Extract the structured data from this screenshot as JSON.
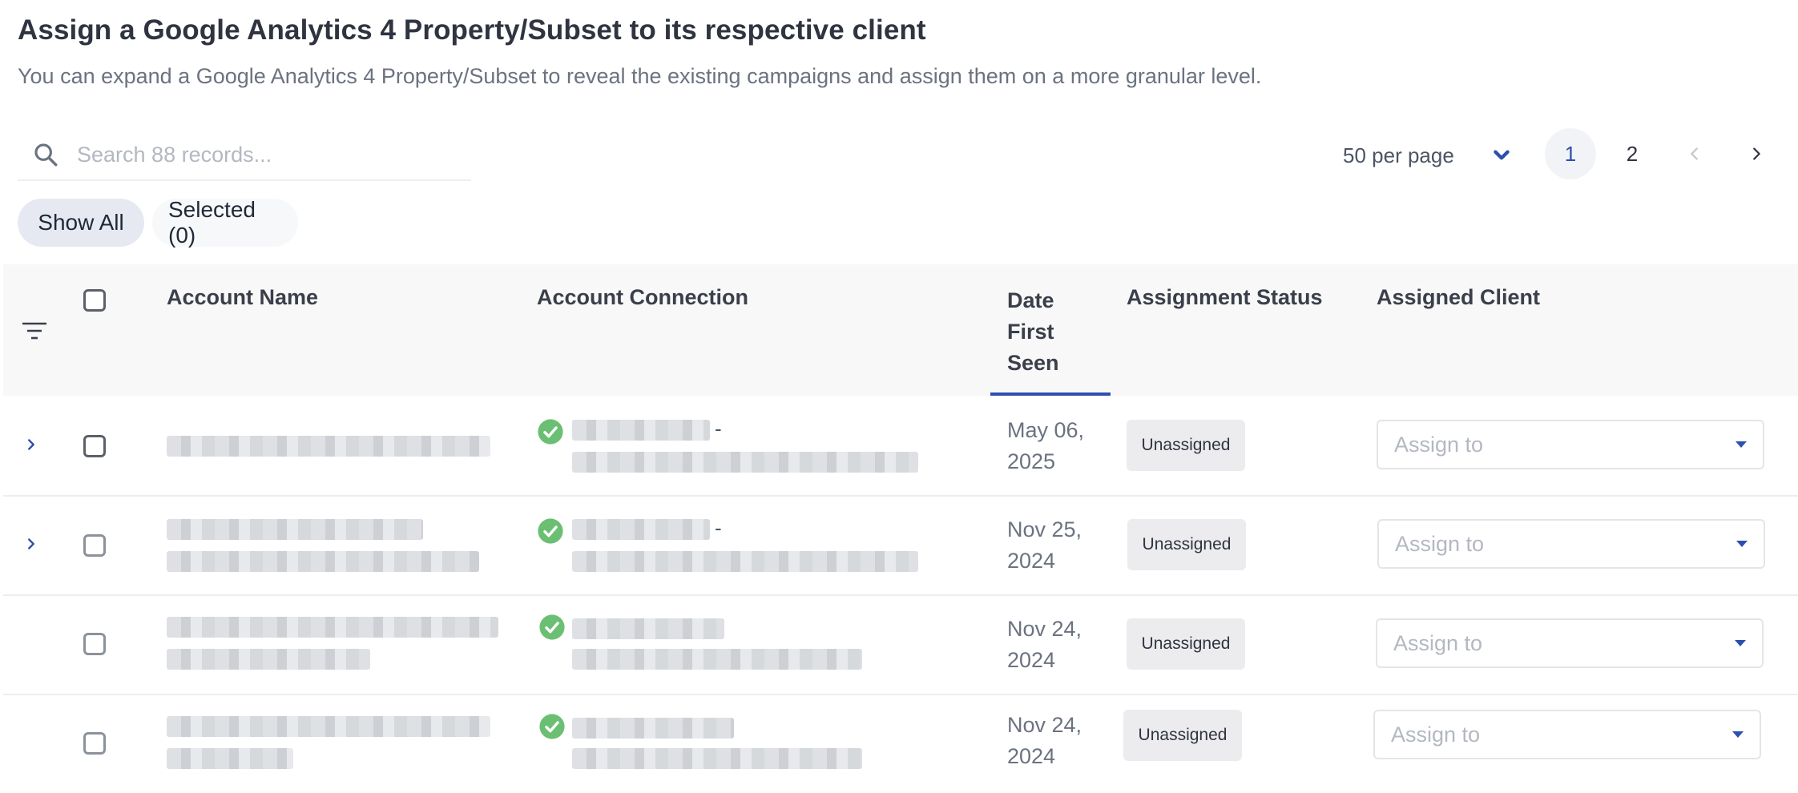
{
  "header": {
    "title": "Assign a Google Analytics 4 Property/Subset to its respective client",
    "subtitle": "You can expand a Google Analytics 4 Property/Subset to reveal the existing campaigns and assign them on a more granular level."
  },
  "search": {
    "placeholder": "Search 88 records..."
  },
  "pagination": {
    "per_page": "50 per page",
    "pages": [
      "1",
      "2"
    ],
    "current_page": "1"
  },
  "filters": {
    "show_all": "Show All",
    "selected": "Selected (0)"
  },
  "table": {
    "columns": {
      "account_name": "Account Name",
      "account_connection": "Account Connection",
      "date_line1": "Date",
      "date_line2": "First",
      "date_line3": "Seen",
      "assignment_status": "Assignment Status",
      "assigned_client": "Assigned Client"
    },
    "rows": [
      {
        "date_line1": "May 06,",
        "date_line2": "2025",
        "status": "Unassigned",
        "assign_placeholder": "Assign to",
        "connection_dash": "-"
      },
      {
        "date_line1": "Nov 25,",
        "date_line2": "2024",
        "status": "Unassigned",
        "assign_placeholder": "Assign to",
        "connection_dash": "-"
      },
      {
        "date_line1": "Nov 24,",
        "date_line2": "2024",
        "status": "Unassigned",
        "assign_placeholder": "Assign to"
      },
      {
        "date_line1": "Nov 24,",
        "date_line2": "2024",
        "status": "Unassigned",
        "assign_placeholder": "Assign to"
      }
    ]
  },
  "colors": {
    "accent": "#2d4fae",
    "success": "#6bbf73",
    "header_bg": "#f8f8f9",
    "badge_bg": "#ececee"
  }
}
